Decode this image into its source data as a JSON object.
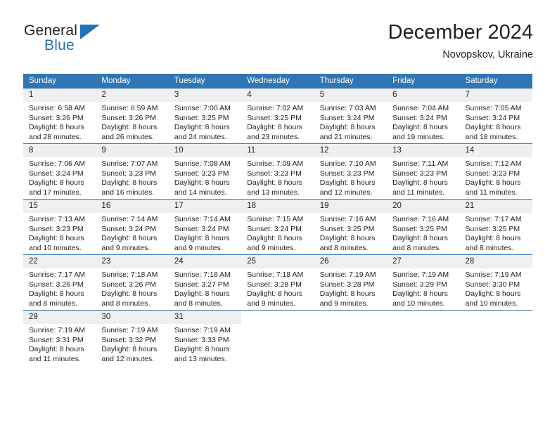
{
  "logo": {
    "word_one": "General",
    "word_two": "Blue",
    "triangle": "blue-triangle-icon"
  },
  "header": {
    "title": "December 2024",
    "location": "Novopskov, Ukraine"
  },
  "colors": {
    "header_blue": "#3075b4",
    "daynum_gray": "#efefef",
    "text": "#231f20",
    "logo_blue": "#2272b4"
  },
  "weekdays": [
    "Sunday",
    "Monday",
    "Tuesday",
    "Wednesday",
    "Thursday",
    "Friday",
    "Saturday"
  ],
  "weeks": [
    [
      {
        "day": "1",
        "sunrise": "Sunrise: 6:58 AM",
        "sunset": "Sunset: 3:26 PM",
        "daylight1": "Daylight: 8 hours",
        "daylight2": "and 28 minutes."
      },
      {
        "day": "2",
        "sunrise": "Sunrise: 6:59 AM",
        "sunset": "Sunset: 3:26 PM",
        "daylight1": "Daylight: 8 hours",
        "daylight2": "and 26 minutes."
      },
      {
        "day": "3",
        "sunrise": "Sunrise: 7:00 AM",
        "sunset": "Sunset: 3:25 PM",
        "daylight1": "Daylight: 8 hours",
        "daylight2": "and 24 minutes."
      },
      {
        "day": "4",
        "sunrise": "Sunrise: 7:02 AM",
        "sunset": "Sunset: 3:25 PM",
        "daylight1": "Daylight: 8 hours",
        "daylight2": "and 23 minutes."
      },
      {
        "day": "5",
        "sunrise": "Sunrise: 7:03 AM",
        "sunset": "Sunset: 3:24 PM",
        "daylight1": "Daylight: 8 hours",
        "daylight2": "and 21 minutes."
      },
      {
        "day": "6",
        "sunrise": "Sunrise: 7:04 AM",
        "sunset": "Sunset: 3:24 PM",
        "daylight1": "Daylight: 8 hours",
        "daylight2": "and 19 minutes."
      },
      {
        "day": "7",
        "sunrise": "Sunrise: 7:05 AM",
        "sunset": "Sunset: 3:24 PM",
        "daylight1": "Daylight: 8 hours",
        "daylight2": "and 18 minutes."
      }
    ],
    [
      {
        "day": "8",
        "sunrise": "Sunrise: 7:06 AM",
        "sunset": "Sunset: 3:24 PM",
        "daylight1": "Daylight: 8 hours",
        "daylight2": "and 17 minutes."
      },
      {
        "day": "9",
        "sunrise": "Sunrise: 7:07 AM",
        "sunset": "Sunset: 3:23 PM",
        "daylight1": "Daylight: 8 hours",
        "daylight2": "and 16 minutes."
      },
      {
        "day": "10",
        "sunrise": "Sunrise: 7:08 AM",
        "sunset": "Sunset: 3:23 PM",
        "daylight1": "Daylight: 8 hours",
        "daylight2": "and 14 minutes."
      },
      {
        "day": "11",
        "sunrise": "Sunrise: 7:09 AM",
        "sunset": "Sunset: 3:23 PM",
        "daylight1": "Daylight: 8 hours",
        "daylight2": "and 13 minutes."
      },
      {
        "day": "12",
        "sunrise": "Sunrise: 7:10 AM",
        "sunset": "Sunset: 3:23 PM",
        "daylight1": "Daylight: 8 hours",
        "daylight2": "and 12 minutes."
      },
      {
        "day": "13",
        "sunrise": "Sunrise: 7:11 AM",
        "sunset": "Sunset: 3:23 PM",
        "daylight1": "Daylight: 8 hours",
        "daylight2": "and 11 minutes."
      },
      {
        "day": "14",
        "sunrise": "Sunrise: 7:12 AM",
        "sunset": "Sunset: 3:23 PM",
        "daylight1": "Daylight: 8 hours",
        "daylight2": "and 11 minutes."
      }
    ],
    [
      {
        "day": "15",
        "sunrise": "Sunrise: 7:13 AM",
        "sunset": "Sunset: 3:23 PM",
        "daylight1": "Daylight: 8 hours",
        "daylight2": "and 10 minutes."
      },
      {
        "day": "16",
        "sunrise": "Sunrise: 7:14 AM",
        "sunset": "Sunset: 3:24 PM",
        "daylight1": "Daylight: 8 hours",
        "daylight2": "and 9 minutes."
      },
      {
        "day": "17",
        "sunrise": "Sunrise: 7:14 AM",
        "sunset": "Sunset: 3:24 PM",
        "daylight1": "Daylight: 8 hours",
        "daylight2": "and 9 minutes."
      },
      {
        "day": "18",
        "sunrise": "Sunrise: 7:15 AM",
        "sunset": "Sunset: 3:24 PM",
        "daylight1": "Daylight: 8 hours",
        "daylight2": "and 9 minutes."
      },
      {
        "day": "19",
        "sunrise": "Sunrise: 7:16 AM",
        "sunset": "Sunset: 3:25 PM",
        "daylight1": "Daylight: 8 hours",
        "daylight2": "and 8 minutes."
      },
      {
        "day": "20",
        "sunrise": "Sunrise: 7:16 AM",
        "sunset": "Sunset: 3:25 PM",
        "daylight1": "Daylight: 8 hours",
        "daylight2": "and 8 minutes."
      },
      {
        "day": "21",
        "sunrise": "Sunrise: 7:17 AM",
        "sunset": "Sunset: 3:25 PM",
        "daylight1": "Daylight: 8 hours",
        "daylight2": "and 8 minutes."
      }
    ],
    [
      {
        "day": "22",
        "sunrise": "Sunrise: 7:17 AM",
        "sunset": "Sunset: 3:26 PM",
        "daylight1": "Daylight: 8 hours",
        "daylight2": "and 8 minutes."
      },
      {
        "day": "23",
        "sunrise": "Sunrise: 7:18 AM",
        "sunset": "Sunset: 3:26 PM",
        "daylight1": "Daylight: 8 hours",
        "daylight2": "and 8 minutes."
      },
      {
        "day": "24",
        "sunrise": "Sunrise: 7:18 AM",
        "sunset": "Sunset: 3:27 PM",
        "daylight1": "Daylight: 8 hours",
        "daylight2": "and 8 minutes."
      },
      {
        "day": "25",
        "sunrise": "Sunrise: 7:18 AM",
        "sunset": "Sunset: 3:28 PM",
        "daylight1": "Daylight: 8 hours",
        "daylight2": "and 9 minutes."
      },
      {
        "day": "26",
        "sunrise": "Sunrise: 7:19 AM",
        "sunset": "Sunset: 3:28 PM",
        "daylight1": "Daylight: 8 hours",
        "daylight2": "and 9 minutes."
      },
      {
        "day": "27",
        "sunrise": "Sunrise: 7:19 AM",
        "sunset": "Sunset: 3:29 PM",
        "daylight1": "Daylight: 8 hours",
        "daylight2": "and 10 minutes."
      },
      {
        "day": "28",
        "sunrise": "Sunrise: 7:19 AM",
        "sunset": "Sunset: 3:30 PM",
        "daylight1": "Daylight: 8 hours",
        "daylight2": "and 10 minutes."
      }
    ],
    [
      {
        "day": "29",
        "sunrise": "Sunrise: 7:19 AM",
        "sunset": "Sunset: 3:31 PM",
        "daylight1": "Daylight: 8 hours",
        "daylight2": "and 11 minutes."
      },
      {
        "day": "30",
        "sunrise": "Sunrise: 7:19 AM",
        "sunset": "Sunset: 3:32 PM",
        "daylight1": "Daylight: 8 hours",
        "daylight2": "and 12 minutes."
      },
      {
        "day": "31",
        "sunrise": "Sunrise: 7:19 AM",
        "sunset": "Sunset: 3:33 PM",
        "daylight1": "Daylight: 8 hours",
        "daylight2": "and 13 minutes."
      },
      {
        "day": "",
        "sunrise": "",
        "sunset": "",
        "daylight1": "",
        "daylight2": ""
      },
      {
        "day": "",
        "sunrise": "",
        "sunset": "",
        "daylight1": "",
        "daylight2": ""
      },
      {
        "day": "",
        "sunrise": "",
        "sunset": "",
        "daylight1": "",
        "daylight2": ""
      },
      {
        "day": "",
        "sunrise": "",
        "sunset": "",
        "daylight1": "",
        "daylight2": ""
      }
    ]
  ]
}
